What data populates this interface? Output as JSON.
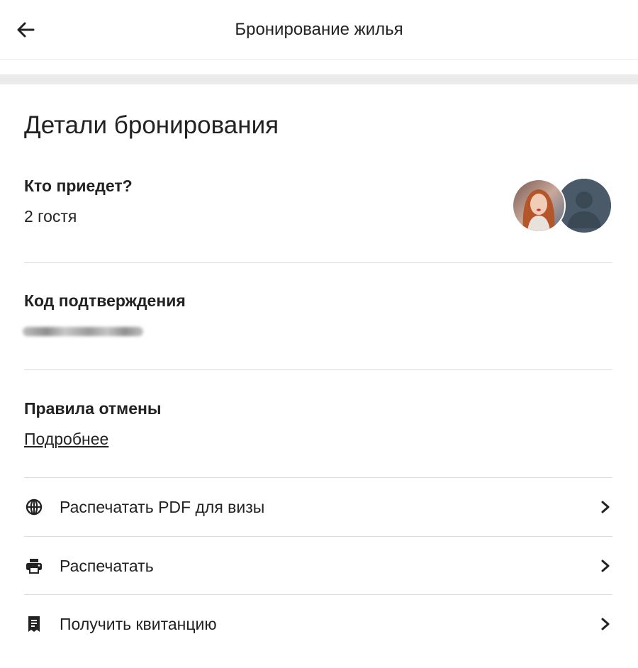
{
  "header": {
    "title": "Бронирование жилья"
  },
  "booking": {
    "section_title": "Детали бронирования",
    "guests": {
      "label": "Кто приедет?",
      "value": "2 гостя"
    },
    "confirmation": {
      "label": "Код подтверждения"
    },
    "cancellation": {
      "label": "Правила отмены",
      "link": "Подробнее"
    }
  },
  "actions": [
    {
      "label": "Распечатать PDF для визы",
      "icon": "globe-icon"
    },
    {
      "label": "Распечатать",
      "icon": "printer-icon"
    },
    {
      "label": "Получить квитанцию",
      "icon": "receipt-icon"
    }
  ],
  "colors": {
    "text": "#222222",
    "divider": "#dddddd",
    "band": "#ebebeb",
    "default_avatar": "#4a5a68"
  }
}
